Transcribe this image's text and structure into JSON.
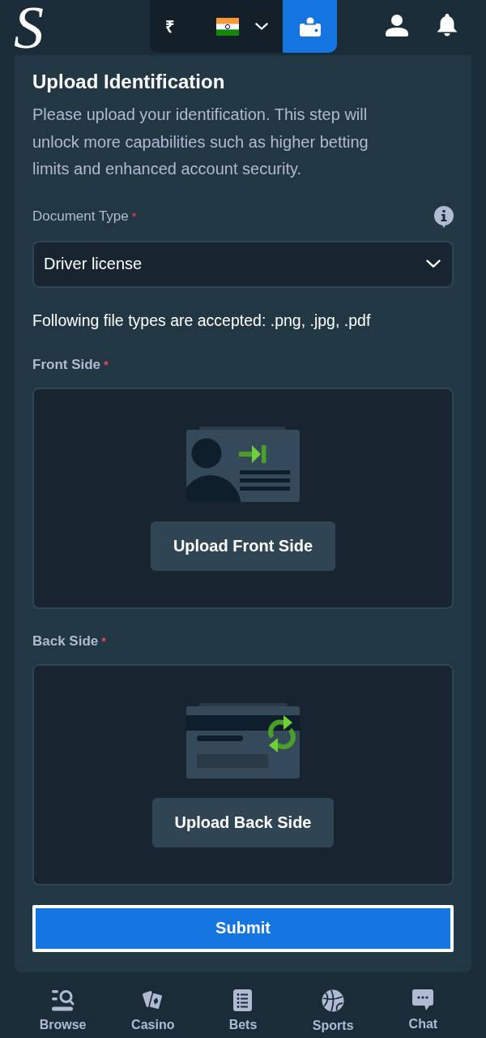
{
  "header": {
    "logo": "S",
    "currency_symbol": "₹"
  },
  "form": {
    "title": "Upload Identification",
    "description": "Please upload your identification. This step will unlock more capabilities such as higher betting limits and enhanced account security.",
    "document_type": {
      "label": "Document Type",
      "required_mark": "*",
      "value": "Driver license"
    },
    "accepted_note": "Following file types are accepted: .png, .jpg, .pdf",
    "uploads": [
      {
        "kind": "front",
        "label": "Front Side",
        "required_mark": "*",
        "button": "Upload Front Side"
      },
      {
        "kind": "back",
        "label": "Back Side",
        "required_mark": "*",
        "button": "Upload Back Side"
      }
    ],
    "submit": {
      "label": "Submit",
      "focused": true
    }
  },
  "bottom_nav": [
    {
      "label": "Browse"
    },
    {
      "label": "Casino"
    },
    {
      "label": "Bets"
    },
    {
      "label": "Sports"
    },
    {
      "label": "Chat"
    }
  ]
}
